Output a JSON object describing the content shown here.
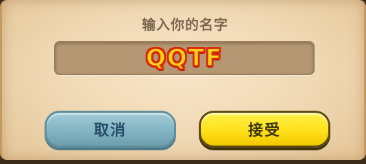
{
  "dialog": {
    "title": "输入你的名字",
    "name_value": "QQTF",
    "cancel_label": "取消",
    "accept_label": "接受"
  },
  "colors": {
    "panel": "#efd7b2",
    "name_box": "#b59774",
    "name_fill": "#ffd21a",
    "name_outline": "#d8290a",
    "cancel_button": "#82b4c3",
    "accept_button": "#ffe21a"
  }
}
